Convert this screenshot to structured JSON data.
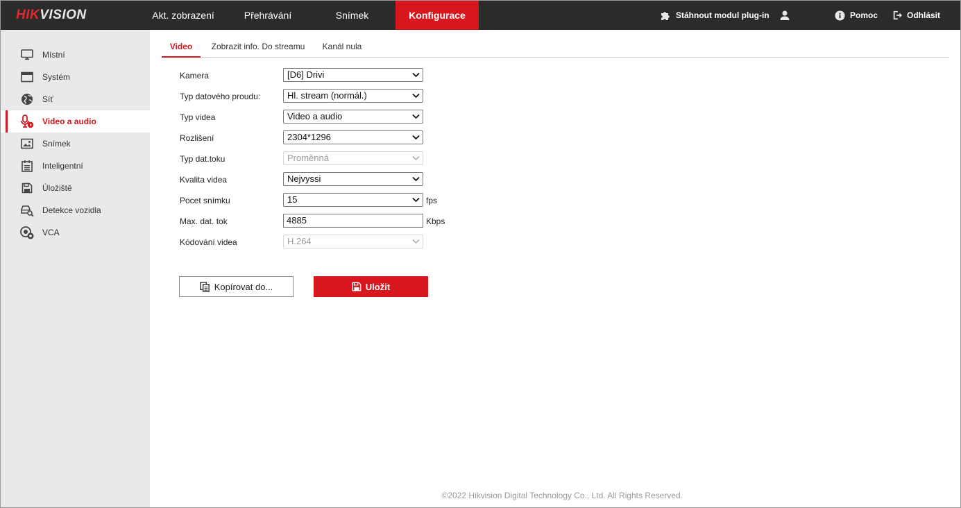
{
  "header": {
    "logo_hik": "HIK",
    "logo_vision": "VISION",
    "nav": [
      {
        "label": "Akt. zobrazení"
      },
      {
        "label": "Přehrávání"
      },
      {
        "label": "Snímek"
      },
      {
        "label": "Konfigurace"
      }
    ],
    "active_nav": "Konfigurace",
    "plugin_label": "Stáhnout modul plug-in",
    "help_label": "Pomoc",
    "logout_label": "Odhlásit"
  },
  "sidebar": {
    "items": [
      {
        "label": "Místní",
        "icon": "monitor-icon"
      },
      {
        "label": "Systém",
        "icon": "window-icon"
      },
      {
        "label": "Síť",
        "icon": "globe-icon"
      },
      {
        "label": "Video a audio",
        "icon": "microphone-icon"
      },
      {
        "label": "Snímek",
        "icon": "image-icon"
      },
      {
        "label": "Inteligentní",
        "icon": "calendar-list-icon"
      },
      {
        "label": "Úložiště",
        "icon": "floppy-icon"
      },
      {
        "label": "Detekce vozidla",
        "icon": "vehicle-search-icon"
      },
      {
        "label": "VCA",
        "icon": "vca-icon"
      }
    ],
    "active": "Video a audio"
  },
  "tabs": [
    {
      "label": "Video"
    },
    {
      "label": "Zobrazit info. Do streamu"
    },
    {
      "label": "Kanál nula"
    }
  ],
  "form": {
    "camera": {
      "label": "Kamera",
      "value": "[D6] Drivi"
    },
    "stream_type": {
      "label": "Typ datového proudu:",
      "value": "Hl. stream (normál.)"
    },
    "video_type": {
      "label": "Typ videa",
      "value": "Video a audio"
    },
    "resolution": {
      "label": "Rozlišení",
      "value": "2304*1296"
    },
    "bitrate_type": {
      "label": "Typ dat.toku",
      "value": "Proměnná"
    },
    "video_quality": {
      "label": "Kvalita videa",
      "value": "Nejvyssi"
    },
    "frame_rate": {
      "label": "Pocet snímku",
      "value": "15",
      "unit": "fps"
    },
    "max_bitrate": {
      "label": "Max. dat. tok",
      "value": "4885",
      "unit": "Kbps"
    },
    "video_encoding": {
      "label": "Kódování videa",
      "value": "H.264"
    }
  },
  "buttons": {
    "copy_label": "Kopírovat do...",
    "save_label": "Uložit"
  },
  "footer": "©2022 Hikvision Digital Technology Co., Ltd. All Rights Reserved.",
  "colors": {
    "accent": "#d7161d",
    "topbar": "#2b2b2b",
    "sidebar": "#e9e9e9"
  }
}
